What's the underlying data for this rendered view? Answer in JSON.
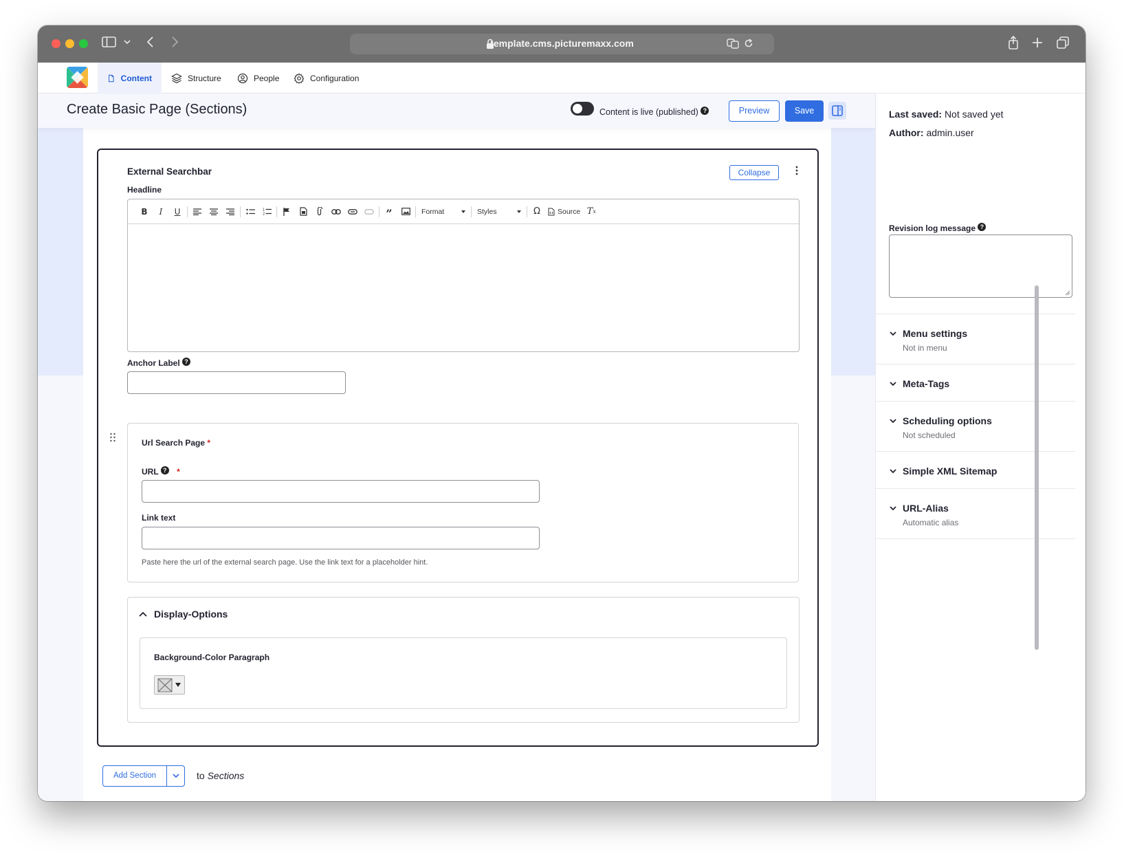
{
  "browser": {
    "url": "template.cms.picturemaxx.com"
  },
  "toolbar": {
    "items": [
      {
        "label": "Content",
        "icon": "file-icon"
      },
      {
        "label": "Structure",
        "icon": "layers-icon"
      },
      {
        "label": "People",
        "icon": "user-circle-icon"
      },
      {
        "label": "Configuration",
        "icon": "gear-icon"
      }
    ]
  },
  "header": {
    "title": "Create Basic Page (Sections)",
    "live_label": "Content is live (published)",
    "preview_label": "Preview",
    "save_label": "Save"
  },
  "section": {
    "title": "External Searchbar",
    "collapse_label": "Collapse",
    "headline_label": "Headline",
    "editor_toolbar": {
      "format_label": "Format",
      "styles_label": "Styles",
      "source_label": "Source"
    },
    "anchor_label": "Anchor Label",
    "url_group": {
      "title": "Url Search Page",
      "required_mark": "*",
      "url_label": "URL",
      "link_text_label": "Link text",
      "hint": "Paste here the url of the external search page. Use the link text for a placeholder hint."
    },
    "display_options": {
      "title": "Display-Options",
      "bg_label": "Background-Color Paragraph"
    }
  },
  "add_section": {
    "button_label": "Add Section",
    "to_prefix": "to",
    "target": "Sections"
  },
  "sidebar": {
    "last_saved_label": "Last saved:",
    "last_saved_value": "Not saved yet",
    "author_label": "Author:",
    "author_value": "admin.user",
    "revision_label": "Revision log message",
    "accordions": [
      {
        "title": "Menu settings",
        "subtitle": "Not in menu"
      },
      {
        "title": "Meta-Tags",
        "subtitle": ""
      },
      {
        "title": "Scheduling options",
        "subtitle": "Not scheduled"
      },
      {
        "title": "Simple XML Sitemap",
        "subtitle": ""
      },
      {
        "title": "URL-Alias",
        "subtitle": "Automatic alias"
      }
    ]
  },
  "colors": {
    "accent": "#2f6de1",
    "page_bg": "#f5f7fd",
    "required": "#d12020"
  }
}
